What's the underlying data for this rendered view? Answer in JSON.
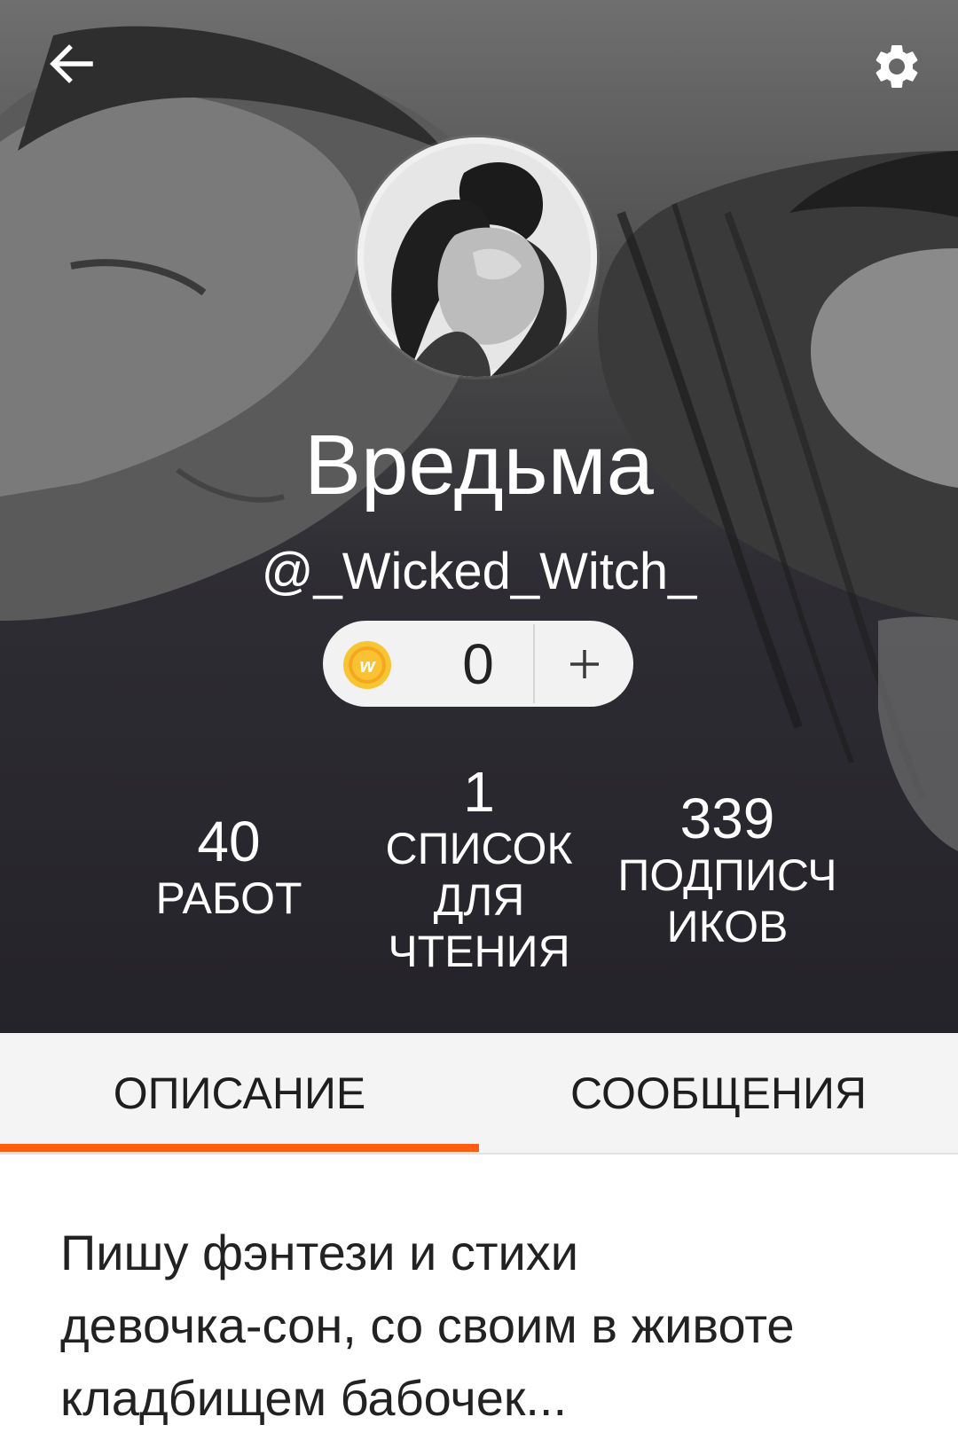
{
  "app": {
    "accent_color": "#ff5d10",
    "header_background": "grayscale illustration of a couple"
  },
  "toolbar": {
    "back_icon": "arrow-left-icon",
    "settings_icon": "gear-icon"
  },
  "profile": {
    "display_name": "Вредьма",
    "username": "@_Wicked_Witch_",
    "avatar": "avatar-image"
  },
  "coins": {
    "icon": "wattpad-coin-icon",
    "value": "0",
    "add_icon": "plus-icon"
  },
  "stats": {
    "works": {
      "value": "40",
      "label": "РАБОТ"
    },
    "reading_lists": {
      "value": "1",
      "label": "СПИСОК\nДЛЯ\nЧТЕНИЯ"
    },
    "followers": {
      "value": "339",
      "label": "ПОДПИСЧ\nИКОВ"
    }
  },
  "tabs": {
    "about": "ОПИСАНИЕ",
    "messages": "СООБЩЕНИЯ",
    "active": "about"
  },
  "about": {
    "text": "Пишу фэнтези и стихи\nдевочка-сон, со своим в животе\nкладбищем бабочек..."
  }
}
